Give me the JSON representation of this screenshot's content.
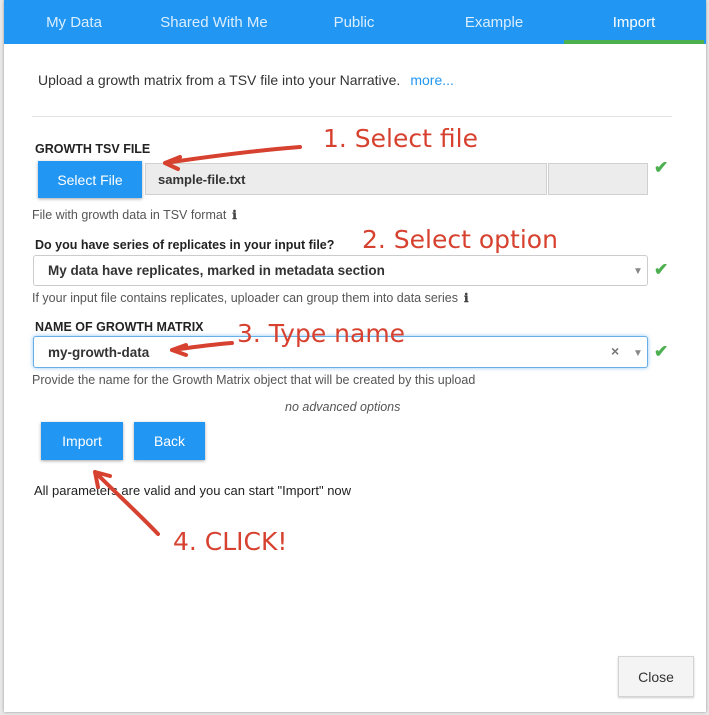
{
  "tabs": [
    {
      "label": "My Data",
      "active": false
    },
    {
      "label": "Shared With Me",
      "active": false
    },
    {
      "label": "Public",
      "active": false
    },
    {
      "label": "Example",
      "active": false
    },
    {
      "label": "Import",
      "active": true
    }
  ],
  "intro": {
    "text": "Upload a growth matrix from a TSV file into your Narrative.",
    "more_link": "more..."
  },
  "growth_file": {
    "label": "GROWTH TSV FILE",
    "button": "Select File",
    "filename": "sample-file.txt",
    "hint": "File with growth data in TSV format",
    "info_icon": "ℹ"
  },
  "replicates": {
    "label": "Do you have series of replicates in your input file?",
    "value": "My data have replicates, marked in metadata section",
    "hint": "If your input file contains replicates, uploader can group them into data series",
    "info_icon": "ℹ"
  },
  "matrix_name": {
    "label": "NAME OF GROWTH MATRIX",
    "value": "my-growth-data",
    "clear": "×",
    "hint": "Provide the name for the Growth Matrix object that will be created by this upload"
  },
  "advanced": "no advanced options",
  "buttons": {
    "import": "Import",
    "back": "Back",
    "close": "Close"
  },
  "status": "All parameters are valid and you can start \"Import\" now",
  "check_mark": "✔",
  "caret": "▼",
  "annotations": {
    "step1": "1. Select file",
    "step2": "2. Select option",
    "step3": "3. Type name",
    "step4": "4. CLICK!"
  },
  "colors": {
    "accent": "#2196f3",
    "tab_underline": "#4caf50",
    "valid": "#4caf50",
    "annotation": "#d7412f"
  }
}
